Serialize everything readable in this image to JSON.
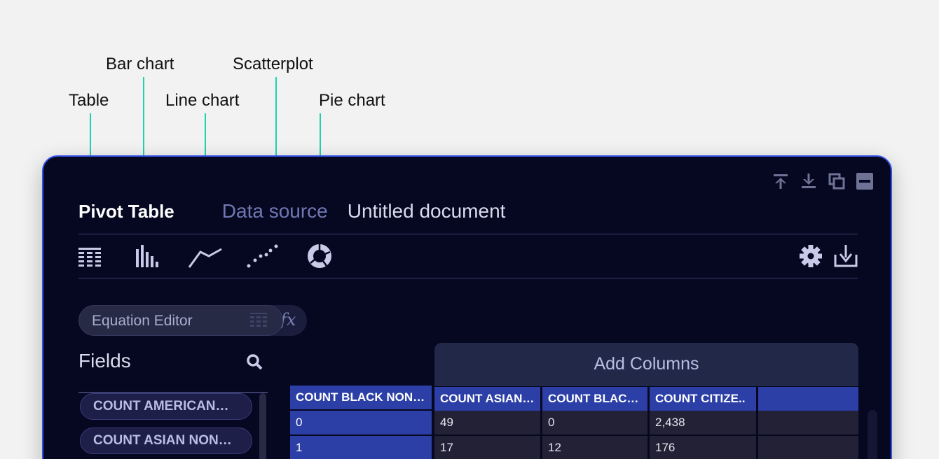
{
  "callouts": {
    "table": "Table",
    "bar": "Bar chart",
    "line": "Line chart",
    "scatter": "Scatterplot",
    "pie": "Pie chart"
  },
  "header": {
    "pivot_title": "Pivot Table",
    "data_source": "Data source",
    "document_title": "Untitled document"
  },
  "window_buttons": [
    "arrow-up-bar-icon",
    "arrow-down-bar-icon",
    "restore-icon",
    "minimize-icon"
  ],
  "toolbar": {
    "icons": [
      "table-icon",
      "bar-chart-icon",
      "line-chart-icon",
      "scatterplot-icon",
      "pie-chart-icon"
    ],
    "right_icons": [
      "gear-icon",
      "download-icon"
    ]
  },
  "equation_editor": {
    "label": "Equation Editor",
    "fx": "fx"
  },
  "fields": {
    "title": "Fields",
    "items": [
      "COUNT AMERICAN…",
      "COUNT ASIAN NON…"
    ]
  },
  "pivot": {
    "add_columns": "Add Columns",
    "row_header": "COUNT BLACK NON…",
    "column_headers": [
      "COUNT ASIAN…",
      "COUNT BLAC…",
      "COUNT CITIZE.."
    ],
    "rows": [
      {
        "key": "0",
        "values": [
          "49",
          "0",
          "2,438"
        ]
      },
      {
        "key": "1",
        "values": [
          "17",
          "12",
          "176"
        ]
      }
    ]
  },
  "colors": {
    "accent": "#1fd1b0",
    "panel_bg": "#060720",
    "panel_border": "#3552e6",
    "header_blue": "#2b3fa6"
  }
}
